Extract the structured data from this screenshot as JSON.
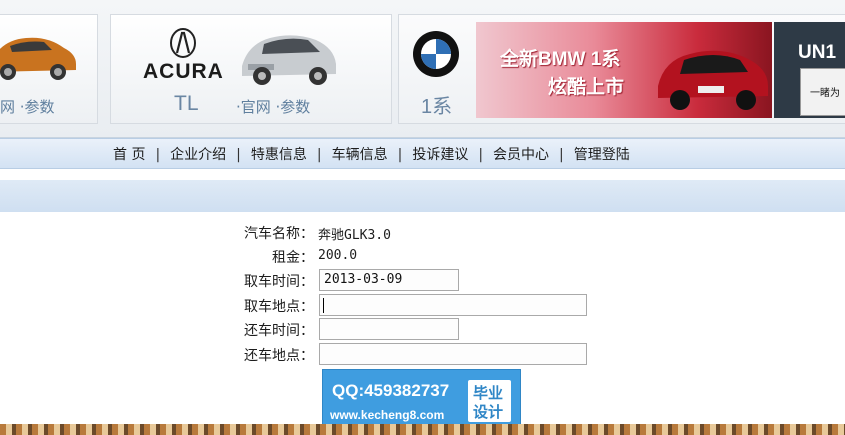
{
  "banner": {
    "panel1": {
      "links": "网 ·参数"
    },
    "panel2": {
      "brand": "ACURA",
      "model": "TL",
      "links": "·官网 ·参数"
    },
    "panel3": {
      "model": "1系"
    },
    "ad": {
      "line1": "全新BMW 1系",
      "line2": "炫酷上市"
    },
    "ad2": {
      "title": "UN1",
      "sub": "一睹为"
    }
  },
  "nav": {
    "items": [
      {
        "label": "首 页"
      },
      {
        "label": "企业介绍"
      },
      {
        "label": "特惠信息"
      },
      {
        "label": "车辆信息"
      },
      {
        "label": "投诉建议"
      },
      {
        "label": "会员中心"
      },
      {
        "label": "管理登陆"
      }
    ],
    "separator": "|"
  },
  "form": {
    "car_name_label": "汽车名称：",
    "car_name_value": "奔驰GLK3.0",
    "rent_label": "租金：",
    "rent_value": "200.0",
    "pickup_time_label": "取车时间：",
    "pickup_time_value": "2013-03-09",
    "pickup_place_label": "取车地点：",
    "pickup_place_value": "",
    "return_time_label": "还车时间：",
    "return_time_value": "",
    "return_place_label": "还车地点：",
    "return_place_value": ""
  },
  "watermark": {
    "qq": "QQ:459382737",
    "url": "www.kecheng8.com",
    "badge_line1": "毕业",
    "badge_line2": "设计"
  },
  "colors": {
    "nav_bg": "#d3e2f3",
    "watermark_bg": "#3f9de0",
    "ad_red": "#c92b3c"
  }
}
